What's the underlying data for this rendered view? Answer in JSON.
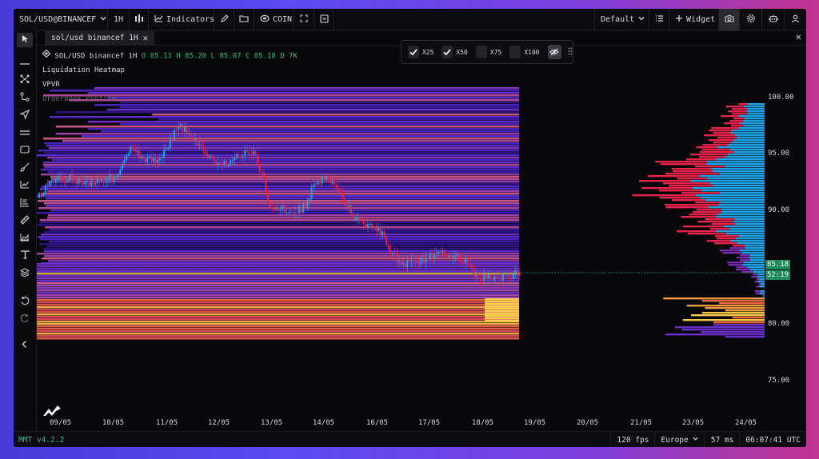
{
  "toolbar": {
    "symbol": "SOL/USD@BINANCEF",
    "interval": "1H",
    "indicators_label": "Indicators",
    "coin_label": "COIN",
    "layout_label": "Default",
    "widget_label": "Widget"
  },
  "tab": {
    "label": "sol/usd binancef 1H"
  },
  "legend": {
    "symbol_line": "SOL/USD binancef 1H",
    "ohlc": "O 85.13 H 85.20 L 85.07 C 85.18 D 7K",
    "heatmap": "Liquidation Heatmap",
    "vpvr": "VPVR",
    "orderbook": "Orderbook Profile"
  },
  "leverage_panel": {
    "items": [
      {
        "label": "X25",
        "checked": true
      },
      {
        "label": "X50",
        "checked": true
      },
      {
        "label": "X75",
        "checked": false
      },
      {
        "label": "X100",
        "checked": false
      }
    ]
  },
  "price_axis": [
    "100.00",
    "95.00",
    "90.00",
    "80.00",
    "75.00"
  ],
  "price_tags": {
    "last": "85.18",
    "countdown": "52:19"
  },
  "time_axis": [
    "09/05",
    "10/05",
    "11/05",
    "12/05",
    "13/05",
    "14/05",
    "16/05",
    "17/05",
    "18/05",
    "19/05",
    "20/05",
    "21/05",
    "23/05",
    "24/05"
  ],
  "status": {
    "version": "MMT v4.2.2",
    "fps": "120 fps",
    "region": "Europe",
    "latency": "57 ms",
    "clock": "06:07:41 UTC"
  },
  "colors": {
    "up": "#1fa3e6",
    "down": "#e8234a",
    "accent_green": "#2dbd87",
    "heat_low": "#3a1aa8",
    "heat_high": "#f2c44a"
  }
}
